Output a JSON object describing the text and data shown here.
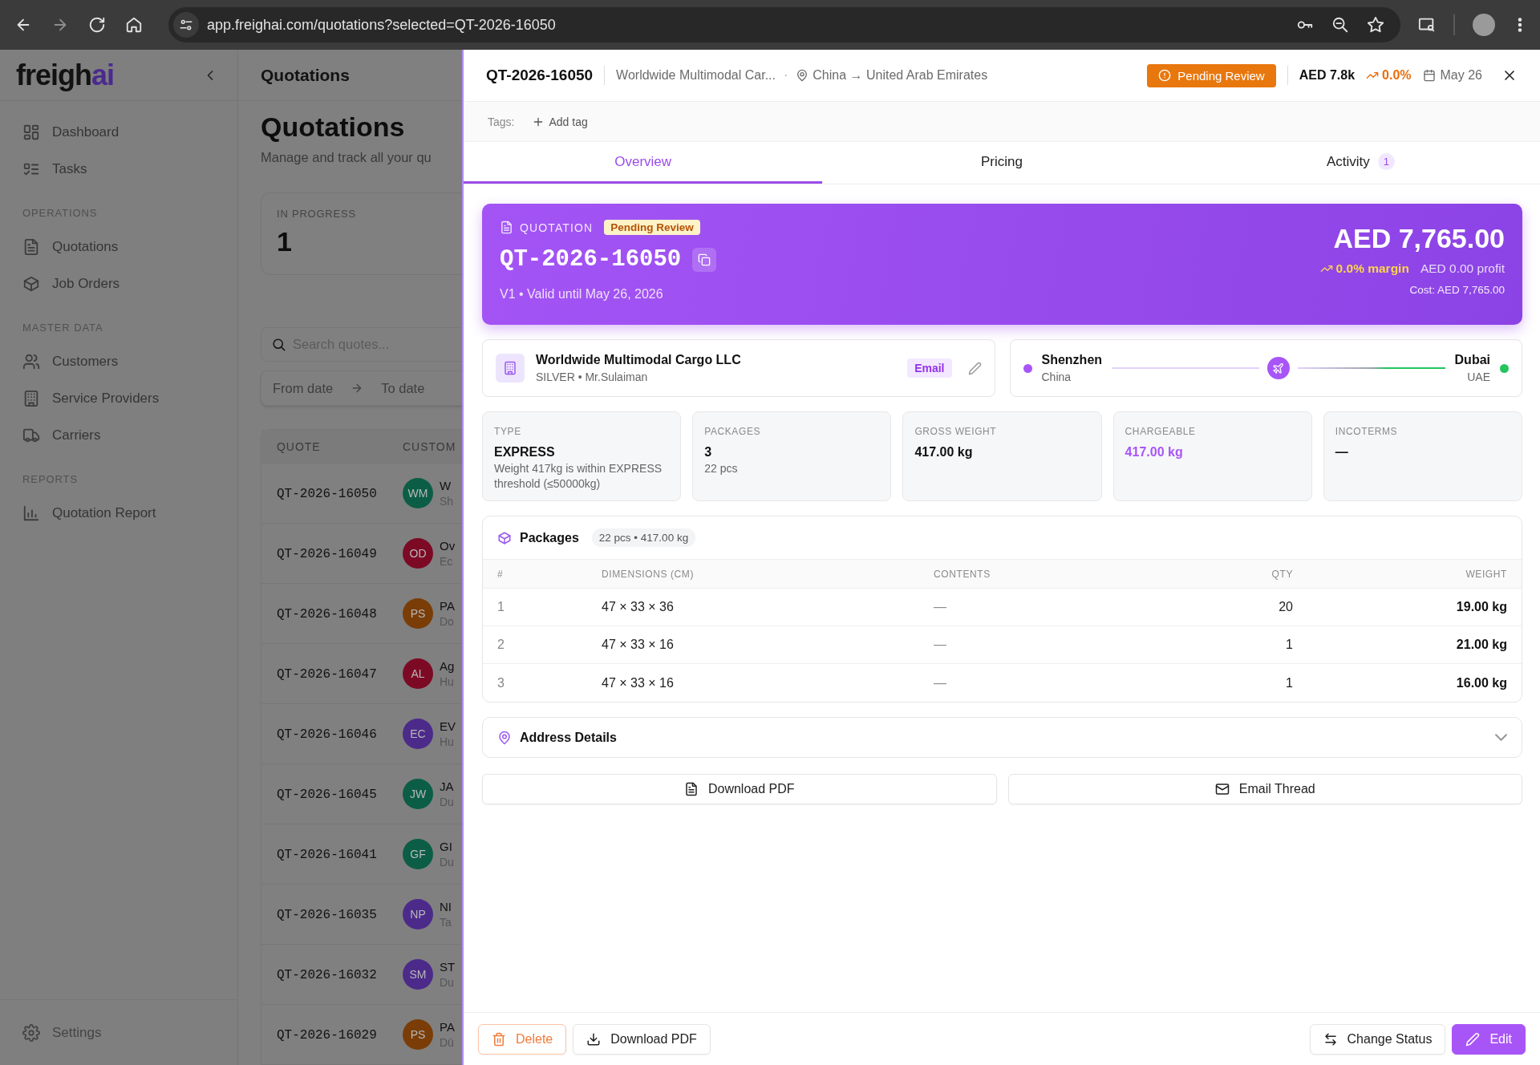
{
  "browser": {
    "url": "app.freighai.com/quotations?selected=QT-2026-16050"
  },
  "sidebar": {
    "logo": {
      "text": "freigh",
      "accent": "ai"
    },
    "sections": [
      {
        "items": [
          "Dashboard",
          "Tasks"
        ]
      },
      {
        "title": "OPERATIONS",
        "items": [
          "Quotations",
          "Job Orders"
        ]
      },
      {
        "title": "MASTER DATA",
        "items": [
          "Customers",
          "Service Providers",
          "Carriers"
        ]
      },
      {
        "title": "REPORTS",
        "items": [
          "Quotation Report"
        ]
      }
    ],
    "footer_item": "Settings"
  },
  "page": {
    "header_title": "Quotations",
    "title": "Quotations",
    "subtitle": "Manage and track all your qu",
    "stat": {
      "label": "IN PROGRESS",
      "value": "1"
    },
    "search": {
      "placeholder": "Search quotes..."
    },
    "date_range": {
      "from_placeholder": "From date",
      "to_placeholder": "To date"
    },
    "table": {
      "columns": [
        "QUOTE",
        "CUSTOM"
      ],
      "rows": [
        {
          "quote": "QT-2026-16050",
          "initials": "WM",
          "color": "#0b5e45",
          "name": "W",
          "detail": "Sh"
        },
        {
          "quote": "QT-2026-16049",
          "initials": "OD",
          "color": "#7c0a25",
          "name": "Ov",
          "detail": "Ec"
        },
        {
          "quote": "QT-2026-16048",
          "initials": "PS",
          "color": "#7a3d07",
          "name": "PA",
          "detail": "Do"
        },
        {
          "quote": "QT-2026-16047",
          "initials": "AL",
          "color": "#7c0a25",
          "name": "Ag",
          "detail": "Hu"
        },
        {
          "quote": "QT-2026-16046",
          "initials": "EC",
          "color": "#4c2a8a",
          "name": "EV",
          "detail": "Hu"
        },
        {
          "quote": "QT-2026-16045",
          "initials": "JW",
          "color": "#0b5e45",
          "name": "JA",
          "detail": "Du"
        },
        {
          "quote": "QT-2026-16041",
          "initials": "GF",
          "color": "#0b5e45",
          "name": "GI",
          "detail": "Du"
        },
        {
          "quote": "QT-2026-16035",
          "initials": "NP",
          "color": "#4c2a8a",
          "name": "NI",
          "detail": "Ta"
        },
        {
          "quote": "QT-2026-16032",
          "initials": "SM",
          "color": "#4c2a8a",
          "name": "ST",
          "detail": "Du"
        },
        {
          "quote": "QT-2026-16029",
          "initials": "PS",
          "color": "#7a3d07",
          "name": "PA",
          "detail": "Dü"
        }
      ]
    }
  },
  "panel": {
    "header": {
      "quote_id": "QT-2026-16050",
      "customer": "Worldwide Multimodal Car...",
      "separator": "·",
      "route": "China → United Arab Emirates",
      "status": "Pending Review",
      "amount": "AED 7.8k",
      "trend": "0.0%",
      "date": "May 26"
    },
    "tags": {
      "label": "Tags:",
      "add": "Add tag"
    },
    "tabs": [
      {
        "label": "Overview",
        "selected": true
      },
      {
        "label": "Pricing",
        "selected": false
      },
      {
        "label": "Activity",
        "selected": false,
        "count": "1"
      }
    ],
    "hero": {
      "label": "QUOTATION",
      "status": "Pending Review",
      "quote_id": "QT-2026-16050",
      "validity": "V1 • Valid until May 26, 2026",
      "total": "AED 7,765.00",
      "margin": "0.0% margin",
      "profit": "AED 0.00 profit",
      "cost": "Cost: AED 7,765.00"
    },
    "customer": {
      "name": "Worldwide Multimodal Cargo LLC",
      "details": "SILVER • Mr.Sulaiman",
      "channel": "Email"
    },
    "route": {
      "origin_city": "Shenzhen",
      "origin_country": "China",
      "destination_city": "Dubai",
      "destination_country": "UAE"
    },
    "stats": [
      {
        "label": "TYPE",
        "value": "EXPRESS",
        "note": "Weight 417kg is within EXPRESS threshold (≤50000kg)",
        "accent": false
      },
      {
        "label": "PACKAGES",
        "value": "3",
        "note": "22 pcs",
        "accent": false
      },
      {
        "label": "GROSS WEIGHT",
        "value": "417.00 kg",
        "accent": false
      },
      {
        "label": "CHARGEABLE",
        "value": "417.00 kg",
        "accent": true
      },
      {
        "label": "INCOTERMS",
        "value": "—",
        "accent": false
      }
    ],
    "packages": {
      "title": "Packages",
      "summary": "22 pcs • 417.00 kg",
      "columns": [
        "#",
        "DIMENSIONS (CM)",
        "CONTENTS",
        "QTY",
        "WEIGHT"
      ],
      "rows": [
        [
          "1",
          "47 × 33 × 36",
          "—",
          "20",
          "19.00 kg"
        ],
        [
          "2",
          "47 × 33 × 16",
          "—",
          "1",
          "21.00 kg"
        ],
        [
          "3",
          "47 × 33 × 16",
          "—",
          "1",
          "16.00 kg"
        ]
      ]
    },
    "address": {
      "title": "Address Details",
      "expanded": false
    },
    "actions": [
      {
        "label": "Download PDF",
        "kind": "pdf"
      },
      {
        "label": "Email Thread",
        "kind": "mail"
      }
    ],
    "footer": {
      "left": [
        {
          "label": "Delete",
          "kind": "danger"
        },
        {
          "label": "Download PDF",
          "kind": "download"
        }
      ],
      "right": [
        {
          "label": "Change Status",
          "kind": "status"
        },
        {
          "label": "Edit",
          "kind": "primary"
        }
      ]
    }
  }
}
